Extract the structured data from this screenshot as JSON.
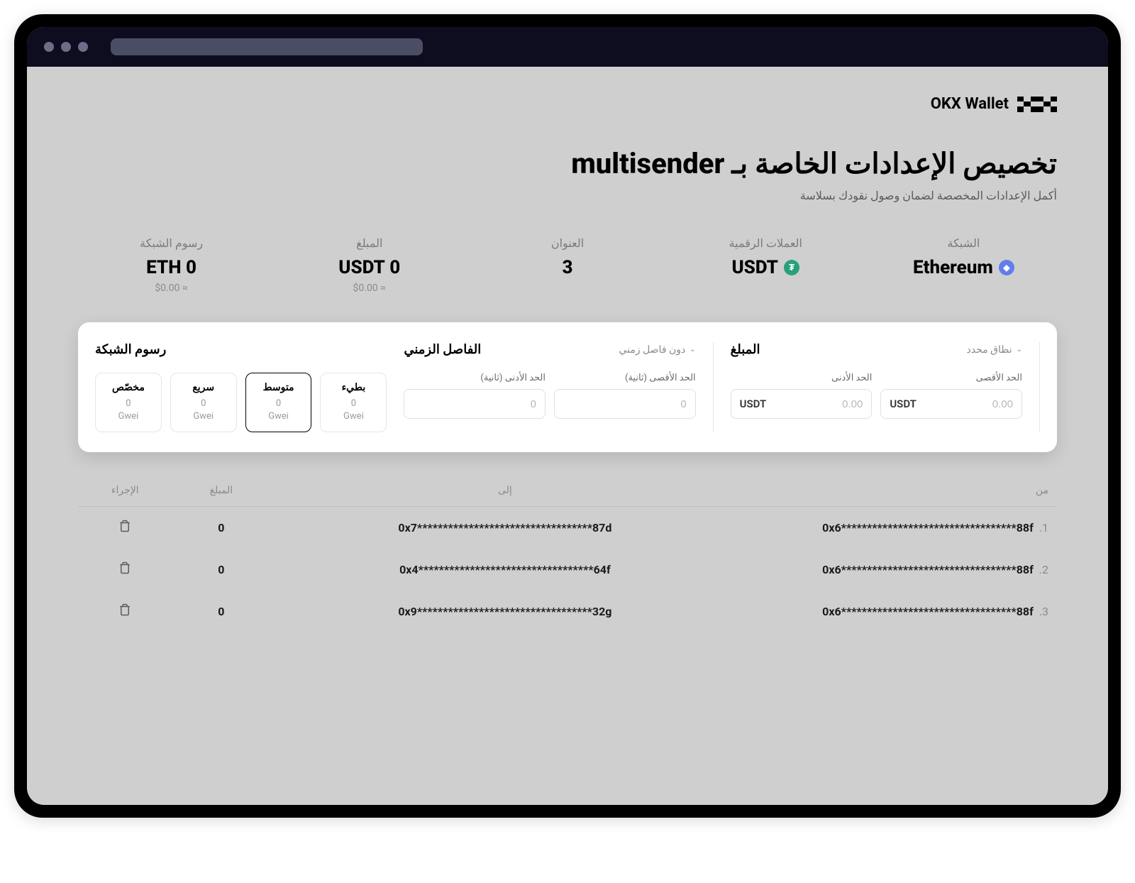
{
  "wallet": {
    "name": "OKX Wallet"
  },
  "page": {
    "title": "تخصيص الإعدادات الخاصة بـ multisender",
    "subtitle": "أكمل الإعدادات المخصصة لضمان وصول نقودك بسلاسة"
  },
  "summary": {
    "network": {
      "label": "الشبكة",
      "value": "Ethereum"
    },
    "token": {
      "label": "العملات الرقمية",
      "value": "USDT"
    },
    "address": {
      "label": "العنوان",
      "value": "3"
    },
    "amount": {
      "label": "المبلغ",
      "value": "0 USDT",
      "sub": "≈ $0.00"
    },
    "fee": {
      "label": "رسوم الشبكة",
      "value": "0 ETH",
      "sub": "≈ $0.00"
    }
  },
  "config": {
    "amount": {
      "title": "المبلغ",
      "mode": "نطاق محدد",
      "min_label": "الحد الأدنى",
      "max_label": "الحد الأقصى",
      "placeholder": "0.00",
      "currency": "USDT"
    },
    "interval": {
      "title": "الفاصل الزمني",
      "mode": "دون فاصل زمني",
      "min_label": "الحد الأدنى (ثانية)",
      "max_label": "الحد الأقصى (ثانية)",
      "placeholder": "0"
    },
    "gas": {
      "title": "رسوم الشبكة",
      "options": [
        {
          "name": "بطيء",
          "value": "0",
          "unit": "Gwei",
          "selected": false
        },
        {
          "name": "متوسط",
          "value": "0",
          "unit": "Gwei",
          "selected": true
        },
        {
          "name": "سريع",
          "value": "0",
          "unit": "Gwei",
          "selected": false
        },
        {
          "name": "مخصّص",
          "value": "0",
          "unit": "Gwei",
          "selected": false
        }
      ]
    }
  },
  "table": {
    "headers": {
      "from": "من",
      "to": "إلى",
      "amount": "المبلغ",
      "action": "الإجراء"
    },
    "rows": [
      {
        "idx": "1.",
        "from": "0x6**********************************88f",
        "to": "0x7**********************************87d",
        "amount": "0"
      },
      {
        "idx": "2.",
        "from": "0x6**********************************88f",
        "to": "0x4**********************************64f",
        "amount": "0"
      },
      {
        "idx": "3.",
        "from": "0x6**********************************88f",
        "to": "0x9**********************************32g",
        "amount": "0"
      }
    ]
  }
}
